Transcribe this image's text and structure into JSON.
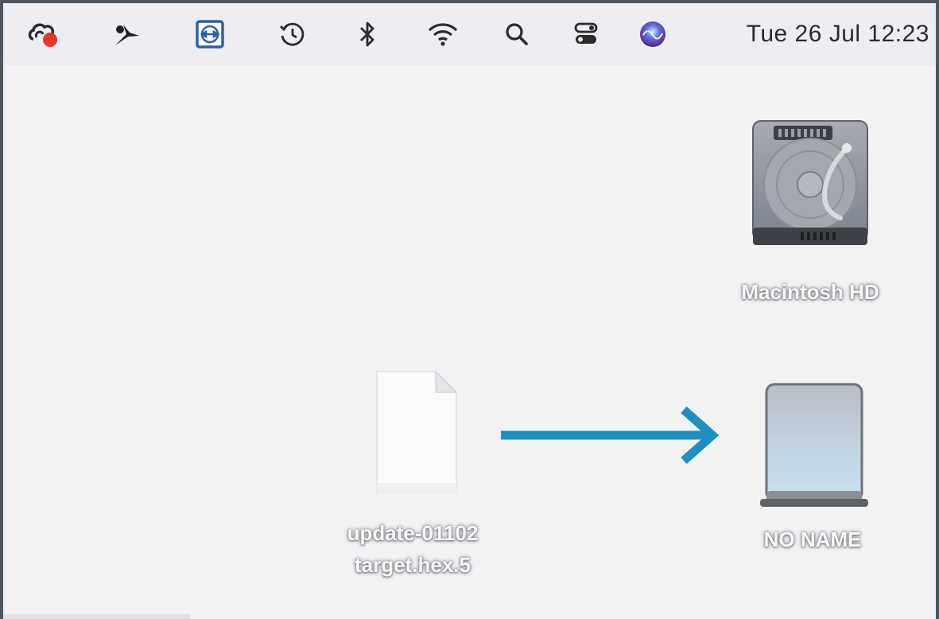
{
  "menubar": {
    "icons": [
      {
        "name": "creative-cloud-status-icon"
      },
      {
        "name": "bird-app-icon"
      },
      {
        "name": "teamviewer-icon"
      },
      {
        "name": "time-machine-icon"
      },
      {
        "name": "bluetooth-icon"
      },
      {
        "name": "wifi-icon"
      },
      {
        "name": "spotlight-search-icon"
      },
      {
        "name": "control-center-icon"
      },
      {
        "name": "siri-icon"
      }
    ],
    "clock": "Tue 26 Jul  12:23"
  },
  "desktop": {
    "items": [
      {
        "label": "Macintosh HD",
        "icon": "internal-hard-drive-icon"
      },
      {
        "label_line1": "update-01102",
        "label_line2": "target.hex.5",
        "icon": "document-file-icon"
      },
      {
        "label": "NO NAME",
        "icon": "external-drive-icon"
      }
    ],
    "arrow_color": "#1f8fc0"
  }
}
